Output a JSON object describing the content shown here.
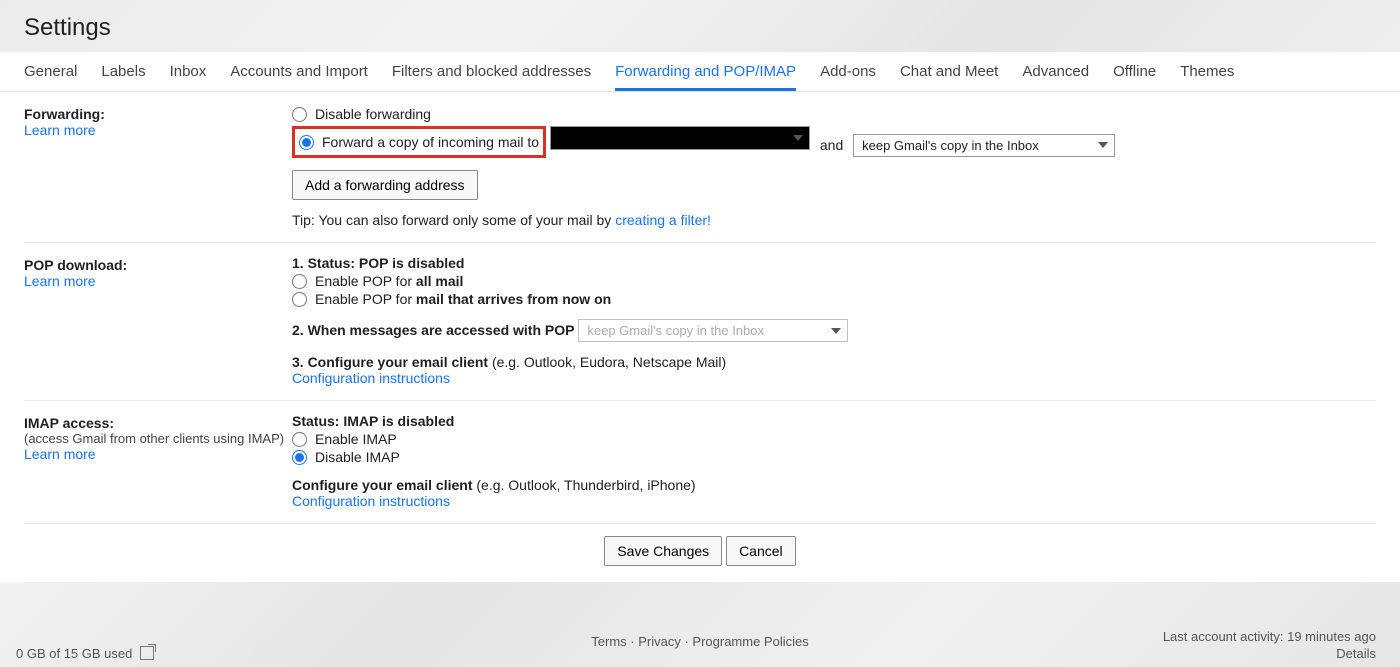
{
  "title": "Settings",
  "tabs": [
    "General",
    "Labels",
    "Inbox",
    "Accounts and Import",
    "Filters and blocked addresses",
    "Forwarding and POP/IMAP",
    "Add-ons",
    "Chat and Meet",
    "Advanced",
    "Offline",
    "Themes"
  ],
  "activeTabIndex": 5,
  "forwarding": {
    "label": "Forwarding:",
    "learn": "Learn more",
    "disable": "Disable forwarding",
    "forward_copy": "Forward a copy of incoming mail to",
    "and": "and",
    "keep_option": "keep Gmail's copy in the Inbox",
    "add_button": "Add a forwarding address",
    "tip_prefix": "Tip: You can also forward only some of your mail by ",
    "tip_link": "creating a filter!"
  },
  "pop": {
    "label": "POP download:",
    "learn": "Learn more",
    "status_prefix": "1. Status: ",
    "status_value": "POP is disabled",
    "enable_all_prefix": "Enable POP for ",
    "enable_all_bold": "all mail",
    "enable_now_prefix": "Enable POP for ",
    "enable_now_bold": "mail that arrives from now on",
    "when_prefix": "2. When messages are accessed with POP",
    "when_option": "keep Gmail's copy in the Inbox",
    "configure_prefix": "3. Configure your email client ",
    "configure_hint": "(e.g. Outlook, Eudora, Netscape Mail)",
    "config_link": "Configuration instructions"
  },
  "imap": {
    "label": "IMAP access:",
    "hint": "(access Gmail from other clients using IMAP)",
    "learn": "Learn more",
    "status_prefix": "Status: ",
    "status_value": "IMAP is disabled",
    "enable": "Enable IMAP",
    "disable": "Disable IMAP",
    "configure_prefix": "Configure your email client ",
    "configure_hint": "(e.g. Outlook, Thunderbird, iPhone)",
    "config_link": "Configuration instructions"
  },
  "buttons": {
    "save": "Save Changes",
    "cancel": "Cancel"
  },
  "footer": {
    "storage": "0 GB of 15 GB used",
    "links": {
      "terms": "Terms",
      "privacy": "Privacy",
      "policies": "Programme Policies"
    },
    "sep": " · ",
    "activity": "Last account activity: 19 minutes ago",
    "details": "Details"
  }
}
